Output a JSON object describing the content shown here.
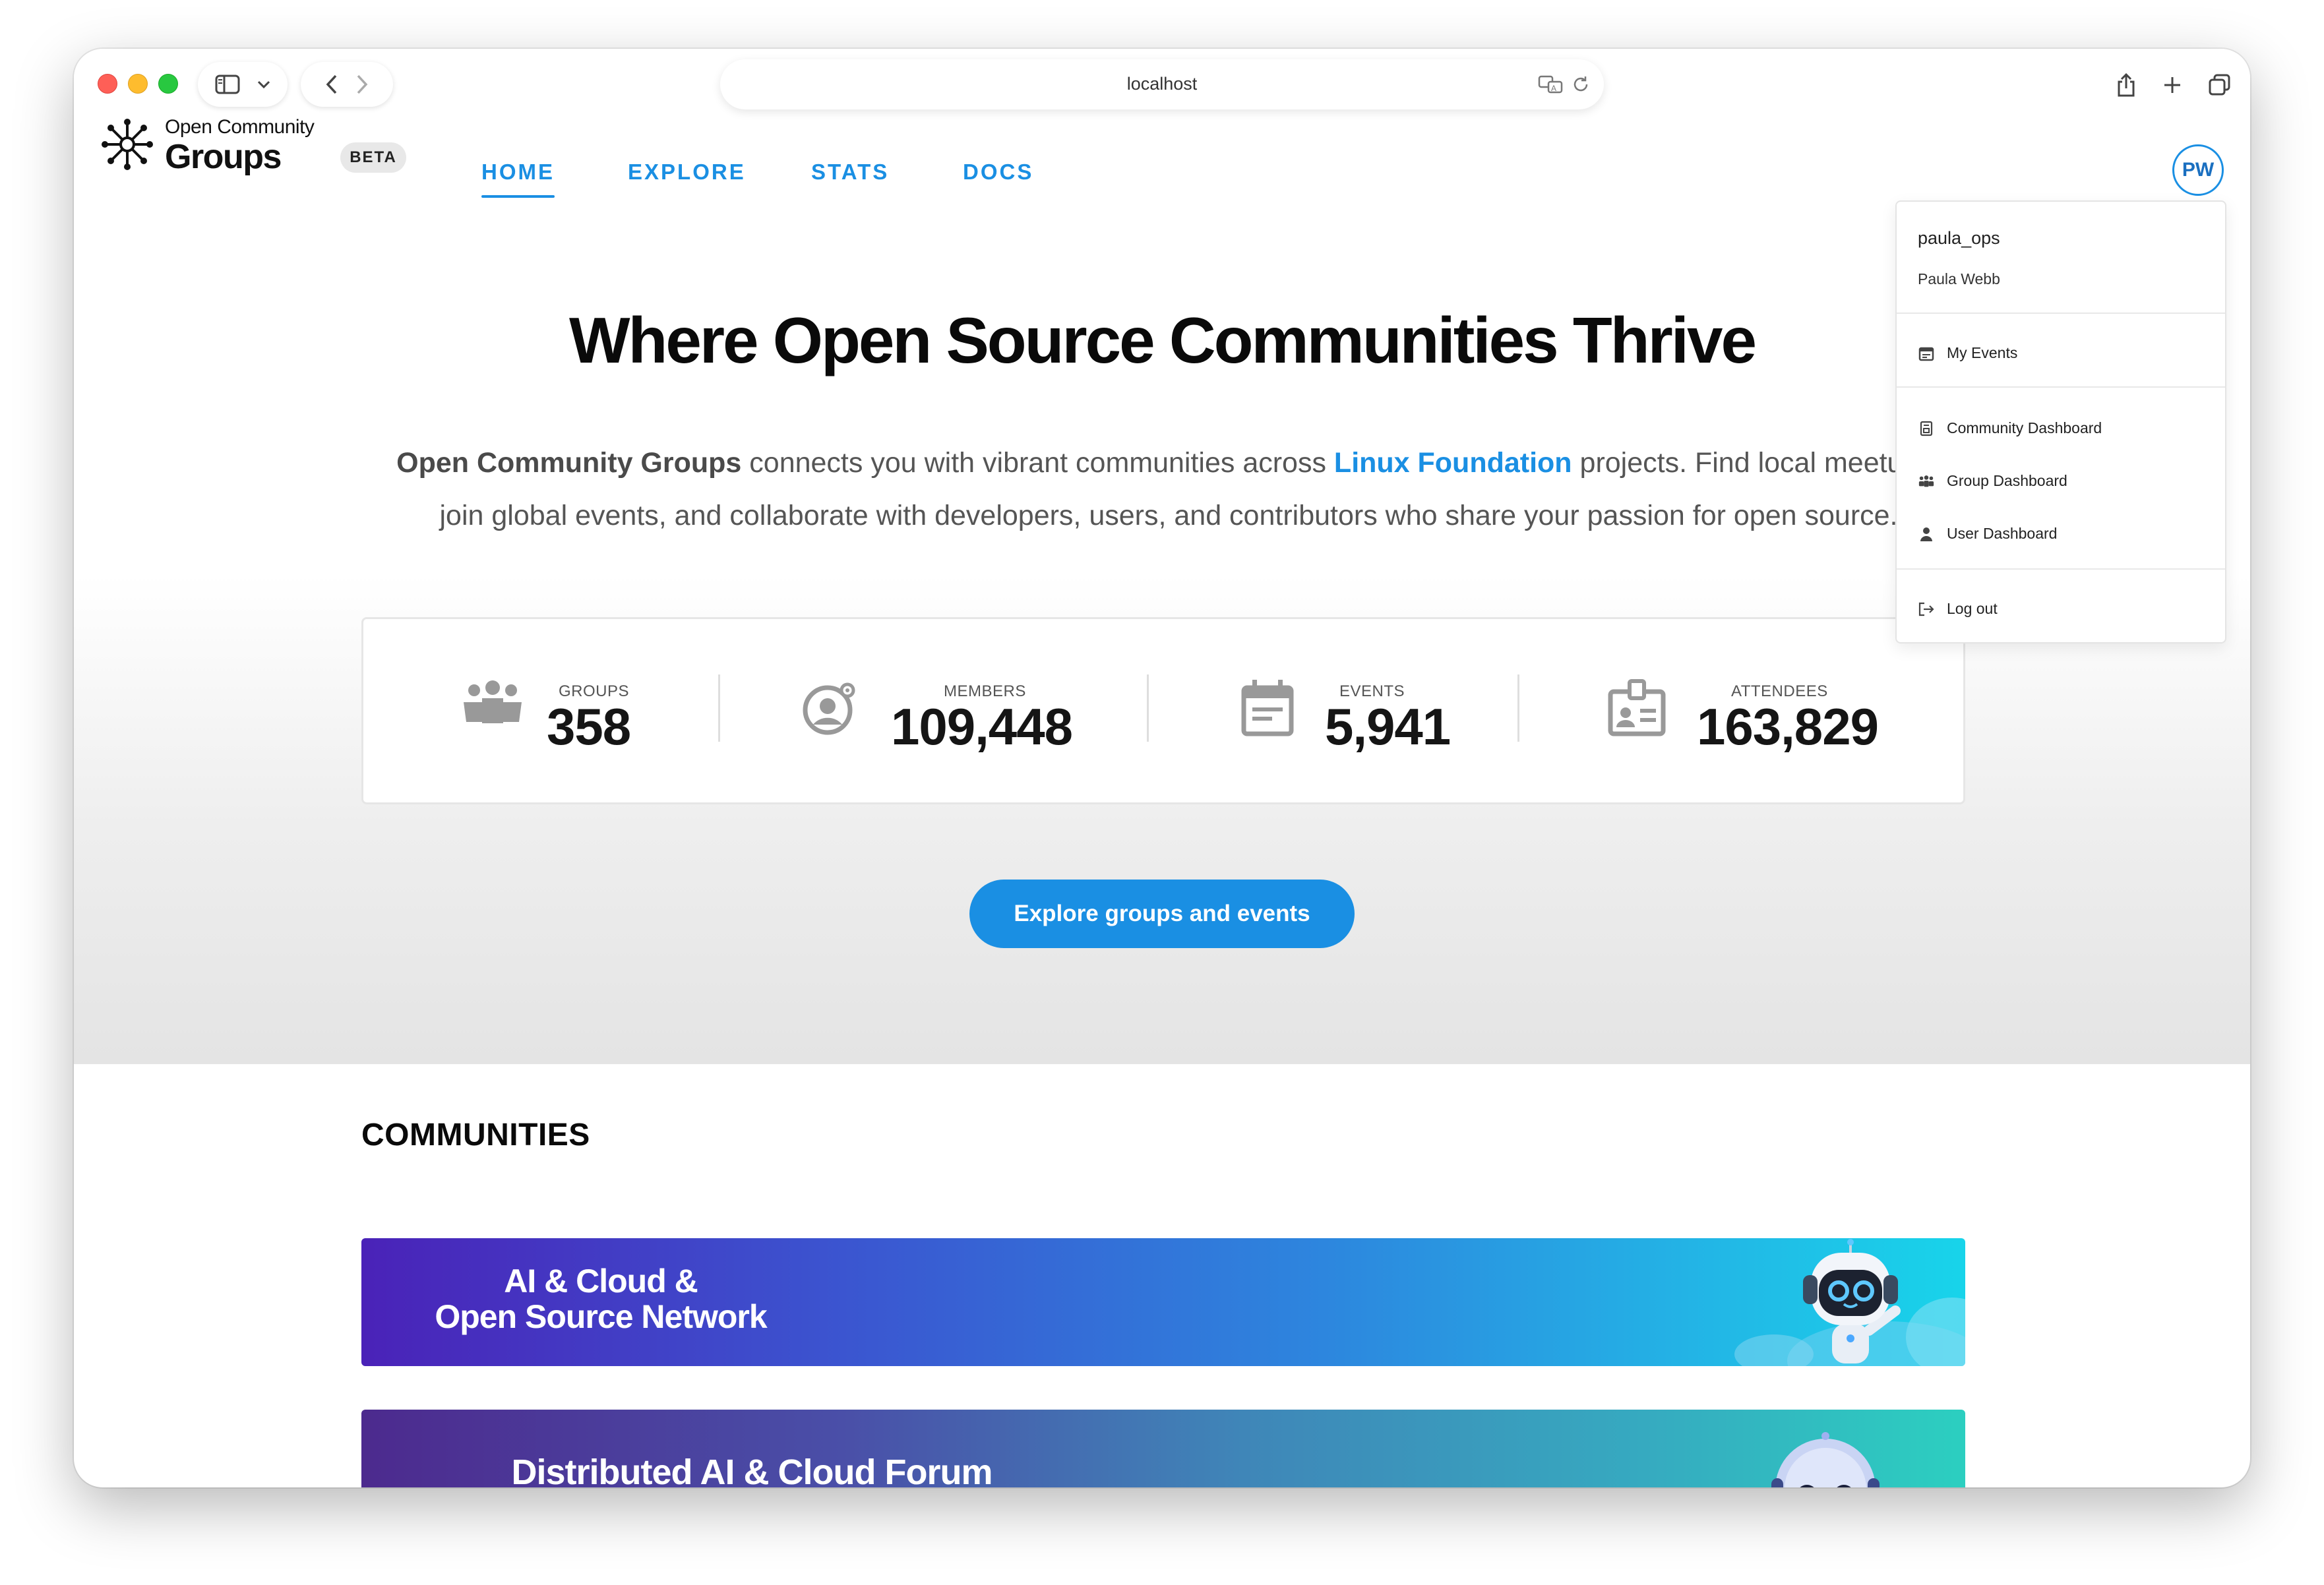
{
  "browser": {
    "url": "localhost"
  },
  "app": {
    "logo_line1": "Open Community",
    "logo_line2": "Groups",
    "badge": "BETA",
    "nav": [
      {
        "label": "HOME",
        "active": true
      },
      {
        "label": "EXPLORE",
        "active": false
      },
      {
        "label": "STATS",
        "active": false
      },
      {
        "label": "DOCS",
        "active": false
      }
    ],
    "avatar_initials": "PW",
    "accent": "#1a8fe3"
  },
  "hero": {
    "title": "Where Open Source Communities Thrive",
    "desc_bold": "Open Community Groups",
    "desc_part1": " connects you with vibrant communities across ",
    "desc_link": "Linux Foundation",
    "desc_part2": " projects. Find local meetups,",
    "desc_line2": "join global events, and collaborate with developers, users, and contributors who share your passion for open source.",
    "cta": "Explore groups and events"
  },
  "stats": [
    {
      "label": "GROUPS",
      "value": "358",
      "icon": "groups-icon"
    },
    {
      "label": "MEMBERS",
      "value": "109,448",
      "icon": "members-icon"
    },
    {
      "label": "EVENTS",
      "value": "5,941",
      "icon": "calendar-icon"
    },
    {
      "label": "ATTENDEES",
      "value": "163,829",
      "icon": "badge-icon"
    }
  ],
  "communities": {
    "title": "COMMUNITIES",
    "banners": [
      {
        "line1": "AI & Cloud &",
        "line2": "Open Source Network"
      },
      {
        "line1": "Distributed AI & Cloud Forum"
      }
    ]
  },
  "user_menu": {
    "username": "paula_ops",
    "full_name": "Paula Webb",
    "items": [
      {
        "label": "My Events",
        "icon": "calendar-icon"
      },
      {
        "label": "Community Dashboard",
        "icon": "dashboard-icon"
      },
      {
        "label": "Group Dashboard",
        "icon": "groups-icon"
      },
      {
        "label": "User Dashboard",
        "icon": "user-icon"
      },
      {
        "label": "Log out",
        "icon": "logout-icon"
      }
    ]
  }
}
